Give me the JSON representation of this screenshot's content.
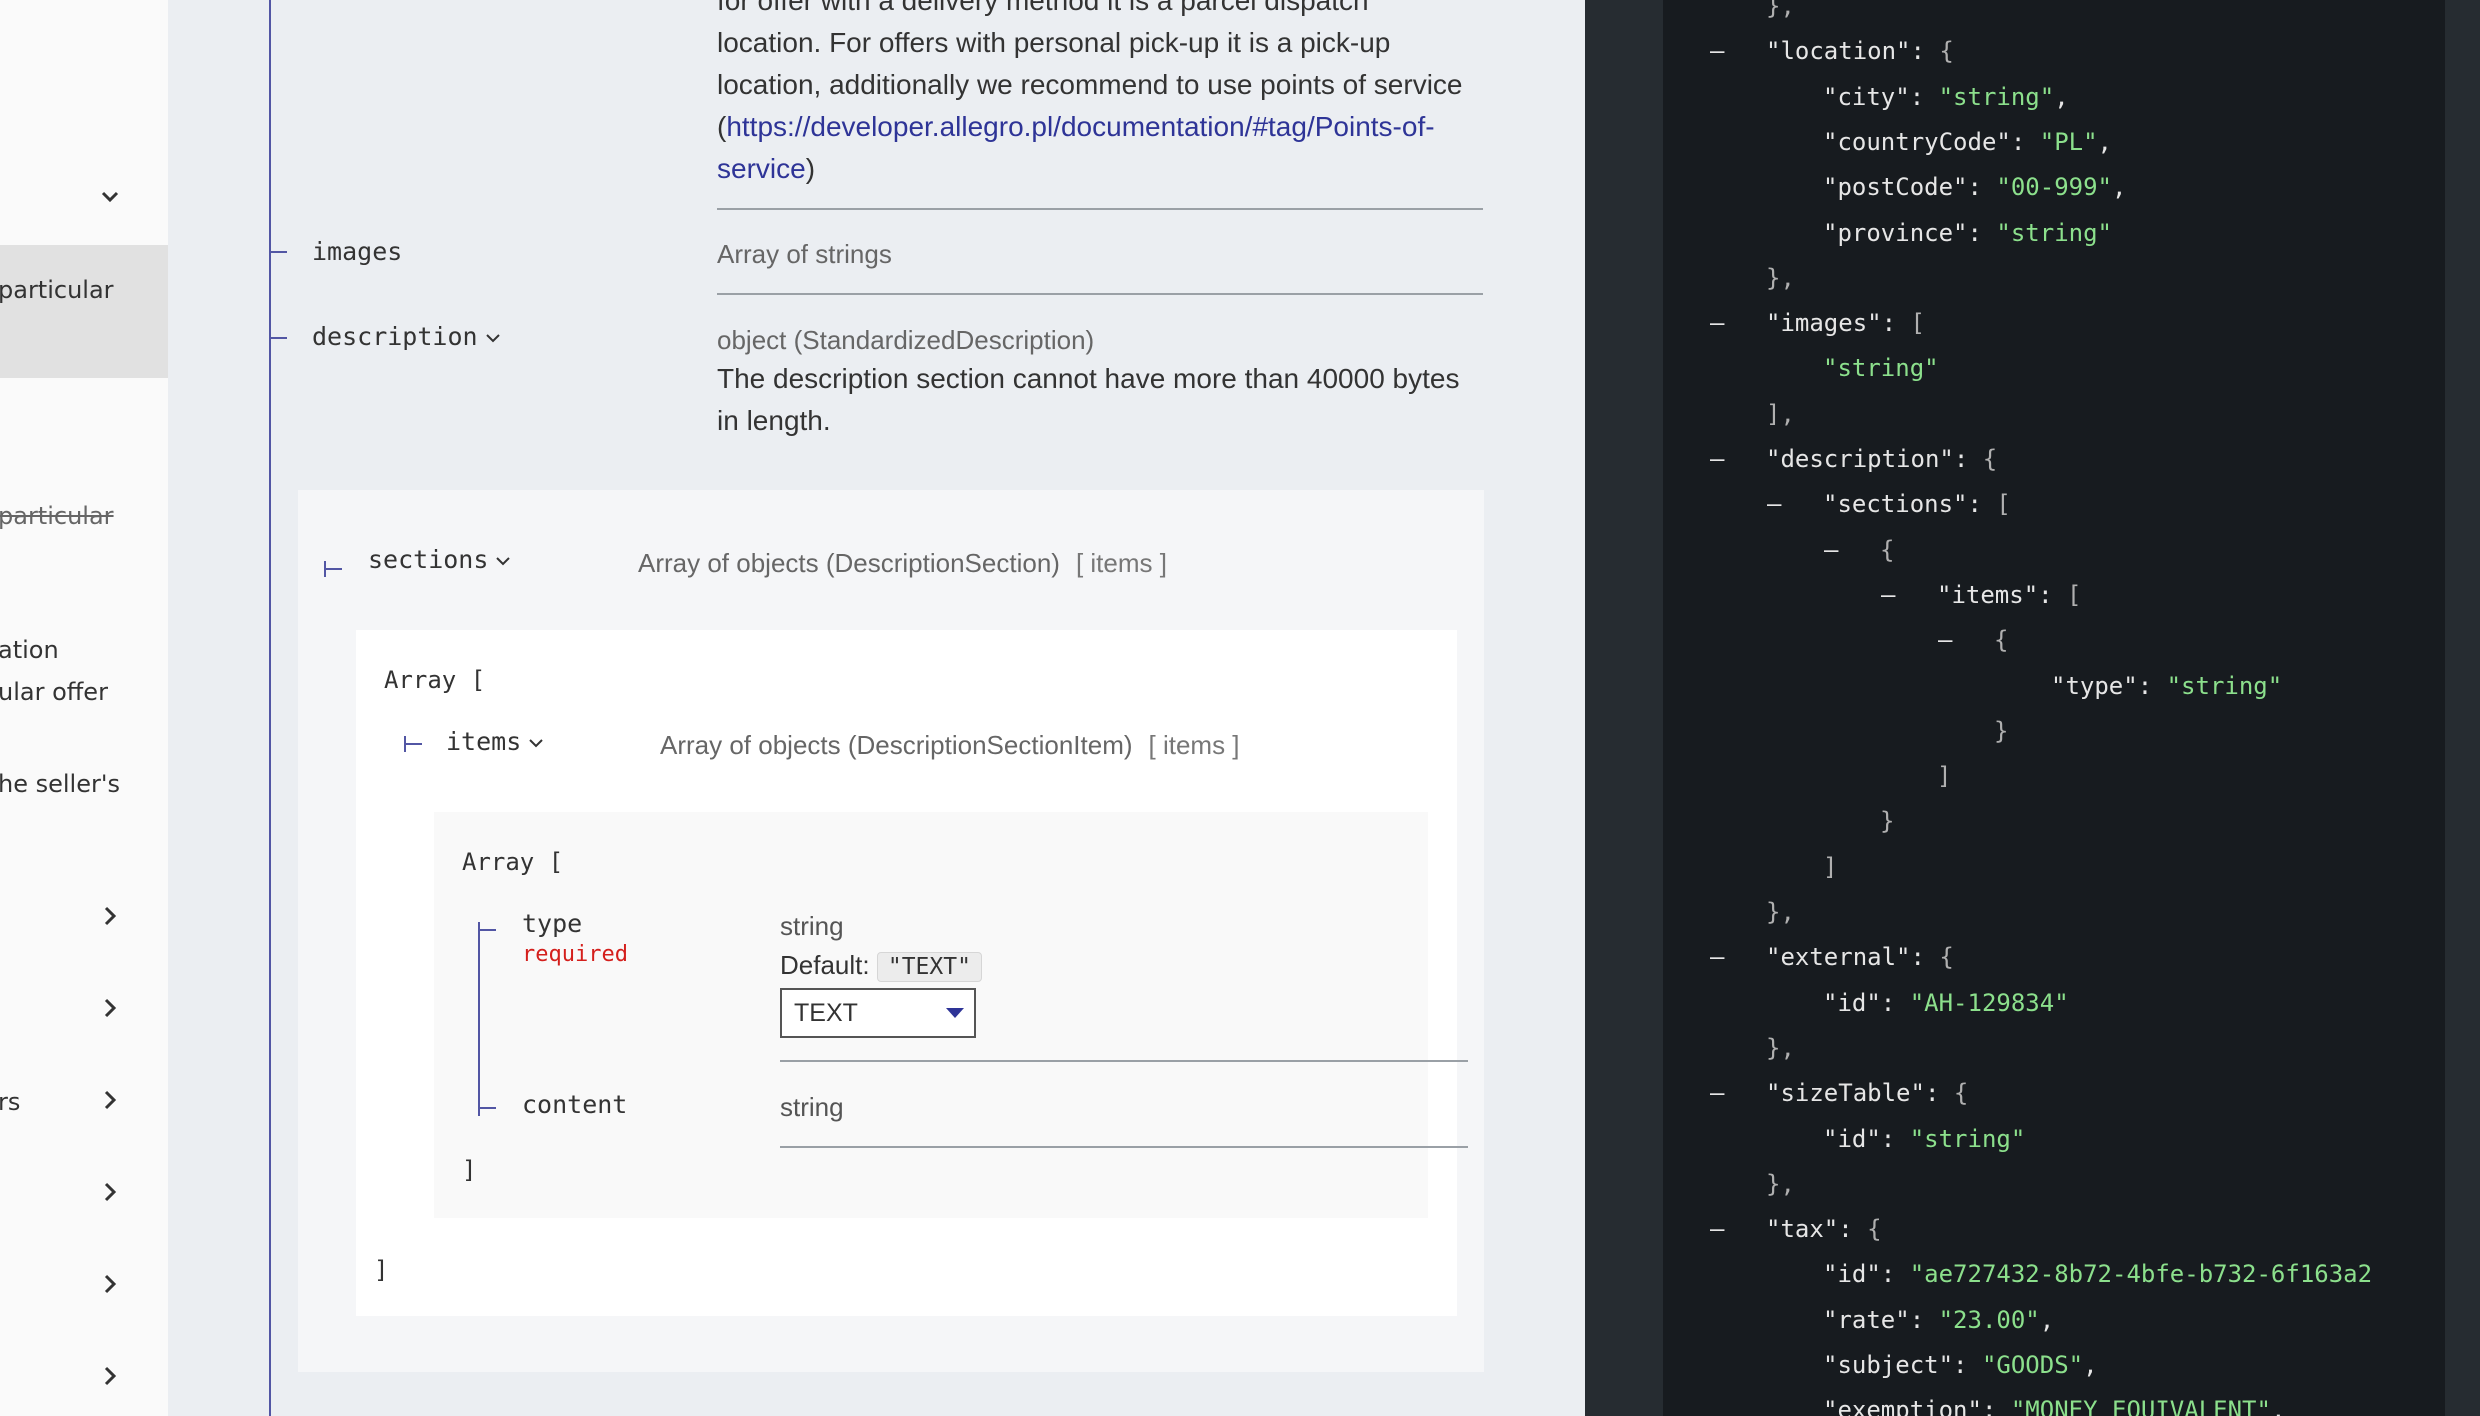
{
  "sidebar": {
    "texts": [
      "particular",
      "particular",
      "ation",
      "ular offer",
      "he seller's",
      "rs"
    ]
  },
  "doc": {
    "top_desc": {
      "line1": "for offer with a delivery method it is a parcel dispatch",
      "line2": "location. For offers with personal pick-up it is a pick-up",
      "line3": "location, additionally we recommend to use points of service",
      "paren_open": "(",
      "link": "https://developer.allegro.pl/documentation/#tag/Points-of-",
      "link2": "service",
      "paren_close": ")"
    },
    "images": {
      "name": "images",
      "type": "Array of strings"
    },
    "description": {
      "name": "description",
      "type": "object (StandardizedDescription)",
      "desc_line1": "The description section cannot have more than 40000 bytes",
      "desc_line2": "in length."
    },
    "sections": {
      "name": "sections",
      "type": "Array of objects (DescriptionSection)",
      "badge": "[ items ]"
    },
    "array_open": "Array [",
    "array_close": "]",
    "items": {
      "name": "items",
      "type": "Array of objects (DescriptionSectionItem)",
      "badge": "[ items ]"
    },
    "type_field": {
      "name": "type",
      "required": "required",
      "type": "string",
      "default_label": "Default:",
      "default_value": "\"TEXT\"",
      "select_value": "TEXT"
    },
    "content_field": {
      "name": "content",
      "type": "string"
    }
  },
  "code": {
    "lines": [
      {
        "i": 0,
        "t": "},"
      },
      {
        "i": 0,
        "d": true,
        "k": "\"location\"",
        "r": ": {"
      },
      {
        "i": 1,
        "k": "\"city\"",
        "v": "\"string\"",
        "e": ","
      },
      {
        "i": 1,
        "k": "\"countryCode\"",
        "v": "\"PL\"",
        "e": ","
      },
      {
        "i": 1,
        "k": "\"postCode\"",
        "v": "\"00-999\"",
        "e": ","
      },
      {
        "i": 1,
        "k": "\"province\"",
        "v": "\"string\""
      },
      {
        "i": 0,
        "t": "},"
      },
      {
        "i": 0,
        "d": true,
        "k": "\"images\"",
        "r": ": ["
      },
      {
        "i": 1,
        "sv": "\"string\""
      },
      {
        "i": 0,
        "t": "],"
      },
      {
        "i": 0,
        "d": true,
        "k": "\"description\"",
        "r": ": {"
      },
      {
        "i": 1,
        "d": true,
        "k": "\"sections\"",
        "r": ": ["
      },
      {
        "i": 2,
        "d": true,
        "t": "{"
      },
      {
        "i": 3,
        "d": true,
        "k": "\"items\"",
        "r": ": ["
      },
      {
        "i": 4,
        "d": true,
        "t": "{"
      },
      {
        "i": 5,
        "k": "\"type\"",
        "v": "\"string\""
      },
      {
        "i": 4,
        "t": "}"
      },
      {
        "i": 3,
        "t": "]"
      },
      {
        "i": 2,
        "t": "}"
      },
      {
        "i": 1,
        "t": "]"
      },
      {
        "i": 0,
        "t": "},"
      },
      {
        "i": 0,
        "d": true,
        "k": "\"external\"",
        "r": ": {"
      },
      {
        "i": 1,
        "k": "\"id\"",
        "v": "\"AH-129834\""
      },
      {
        "i": 0,
        "t": "},"
      },
      {
        "i": 0,
        "d": true,
        "k": "\"sizeTable\"",
        "r": ": {"
      },
      {
        "i": 1,
        "k": "\"id\"",
        "v": "\"string\""
      },
      {
        "i": 0,
        "t": "},"
      },
      {
        "i": 0,
        "d": true,
        "k": "\"tax\"",
        "r": ": {"
      },
      {
        "i": 1,
        "k": "\"id\"",
        "v": "\"ae727432-8b72-4bfe-b732-6f163a2"
      },
      {
        "i": 1,
        "k": "\"rate\"",
        "v": "\"23.00\"",
        "e": ","
      },
      {
        "i": 1,
        "k": "\"subject\"",
        "v": "\"GOODS\"",
        "e": ","
      },
      {
        "i": 1,
        "k": "\"exemption\"",
        "v": "\"MONEY_EQUIVALENT\"",
        "e": ","
      }
    ]
  }
}
